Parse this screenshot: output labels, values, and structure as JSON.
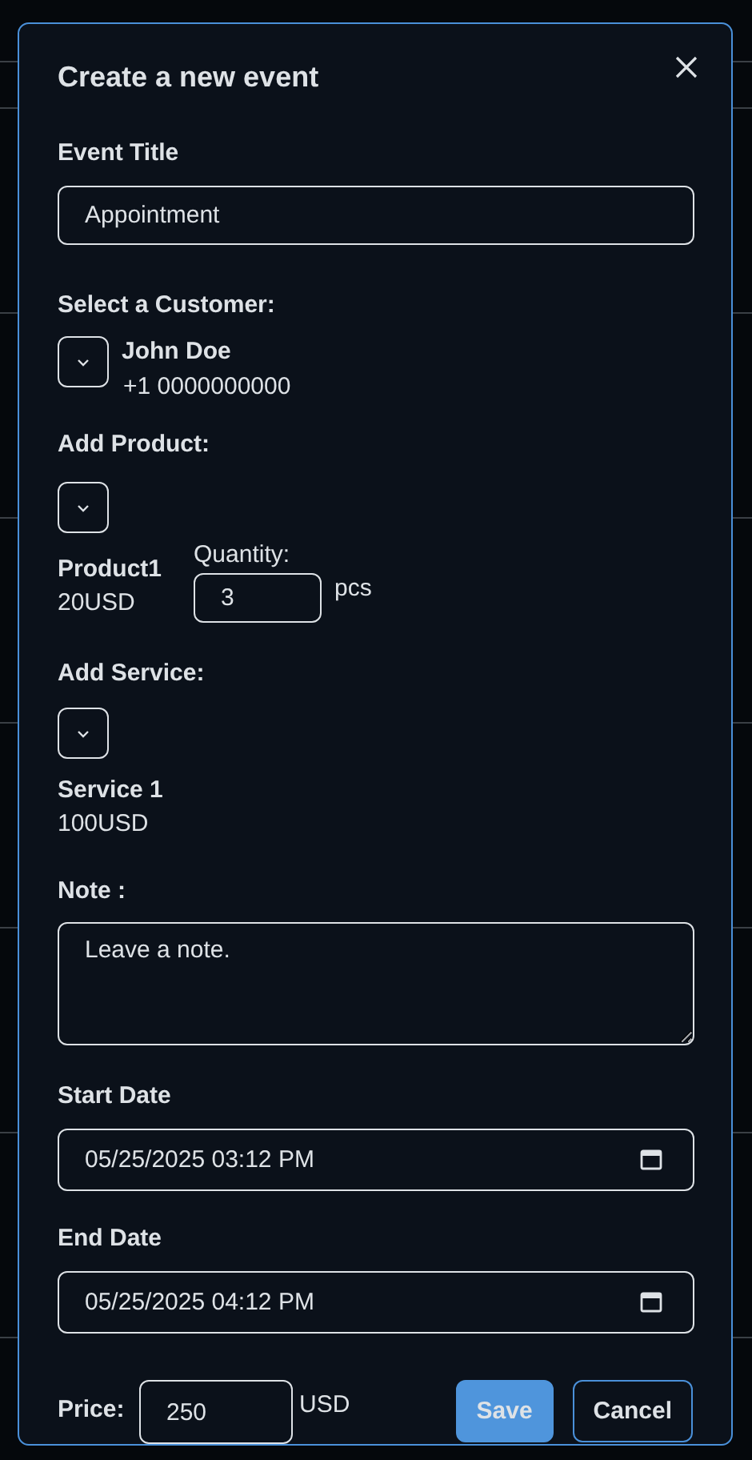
{
  "dialog": {
    "title": "Create a new event"
  },
  "event_title": {
    "label": "Event Title",
    "value": "Appointment"
  },
  "customer": {
    "label": "Select a Customer:",
    "name": "John Doe",
    "phone": "+1 0000000000"
  },
  "product": {
    "label": "Add Product:",
    "name": "Product1",
    "price": "20USD",
    "quantity_label": "Quantity:",
    "quantity": "3",
    "unit": "pcs"
  },
  "service": {
    "label": "Add Service:",
    "name": "Service 1",
    "price": "100USD"
  },
  "note": {
    "label": "Note :",
    "placeholder": "Leave a note."
  },
  "start_date": {
    "label": "Start Date",
    "value": "05/25/2025 03:12 PM"
  },
  "end_date": {
    "label": "End Date",
    "value": "05/25/2025 04:12 PM"
  },
  "price": {
    "label": "Price:",
    "value": "250",
    "currency": "USD"
  },
  "buttons": [
    {
      "label": "Save",
      "kind": "primary"
    },
    {
      "label": "Cancel",
      "kind": "secondary"
    }
  ]
}
